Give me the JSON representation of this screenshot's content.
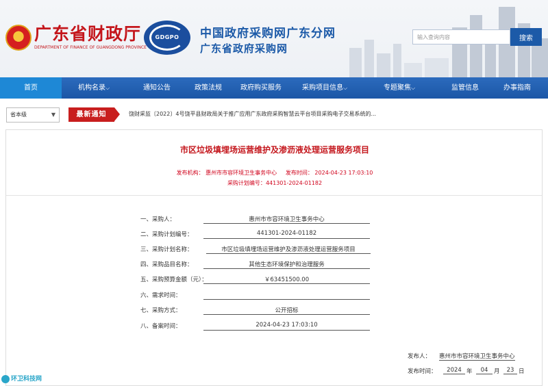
{
  "header": {
    "dept_name": "广东省财政厅",
    "dept_name_en": "DEPARTMENT OF FINANCE OF GUANGDONG PROVINCE",
    "gdgpo_logo": "GDGPO",
    "site_name_1": "中国政府采购网广东分网",
    "site_name_2": "广东省政府采购网",
    "search_placeholder": "输入查询内容",
    "search_button": "搜索"
  },
  "nav": {
    "items": [
      {
        "label": "首页"
      },
      {
        "label": "机构名录"
      },
      {
        "label": "通知公告"
      },
      {
        "label": "政策法规"
      },
      {
        "label": "政府购买服务"
      },
      {
        "label": "采购项目信息"
      },
      {
        "label": "专题聚焦"
      },
      {
        "label": "监管信息"
      },
      {
        "label": "办事指南"
      }
    ]
  },
  "notice": {
    "province_select": "省本级",
    "tag": "最新通知",
    "text": "饶财采监〔2022〕4号饶平县财政局关于推广应用广东政府采购智慧云平台项目采购电子交易系统的..."
  },
  "article": {
    "title": "市区垃圾填埋场运营维护及渗沥液处理运营服务项目",
    "publisher_label": "发布机构：",
    "publisher": "惠州市市容环境卫生事务中心",
    "time_label": "发布时间：",
    "time": "2024-04-23 17:03:10",
    "plan_no_label": "采购计划编号：",
    "plan_no": "441301-2024-01182"
  },
  "fields": [
    {
      "label": "一、采购人：",
      "value": "惠州市市容环境卫生事务中心"
    },
    {
      "label": "二、采购计划编号：",
      "value": "441301-2024-01182"
    },
    {
      "label": "三、采购计划名称：",
      "value": "市区垃圾填埋场运营维护及渗沥液处理运营服务项目"
    },
    {
      "label": "四、采购品目名称：",
      "value": "其他生态环境保护和治理服务"
    },
    {
      "label": "五、采购预算金额（元）：",
      "value": "￥63451500.00"
    },
    {
      "label": "六、需求时间：",
      "value": ""
    },
    {
      "label": "七、采购方式：",
      "value": "公开招标"
    },
    {
      "label": "八、备案时间：",
      "value": "2024-04-23 17:03:10"
    }
  ],
  "footer": {
    "publisher_label": "发布人：",
    "publisher": "惠州市市容环境卫生事务中心",
    "date_label": "发布时间：",
    "year": "2024",
    "year_unit": "年",
    "month": "04",
    "month_unit": "月",
    "day": "23",
    "day_unit": "日"
  },
  "watermark": "环卫科技网",
  "colors": {
    "nav_blue": "#1b56a6",
    "nav_active": "#1e88d6",
    "brand_red": "#c4161c",
    "site_blue": "#1c5aa8"
  }
}
